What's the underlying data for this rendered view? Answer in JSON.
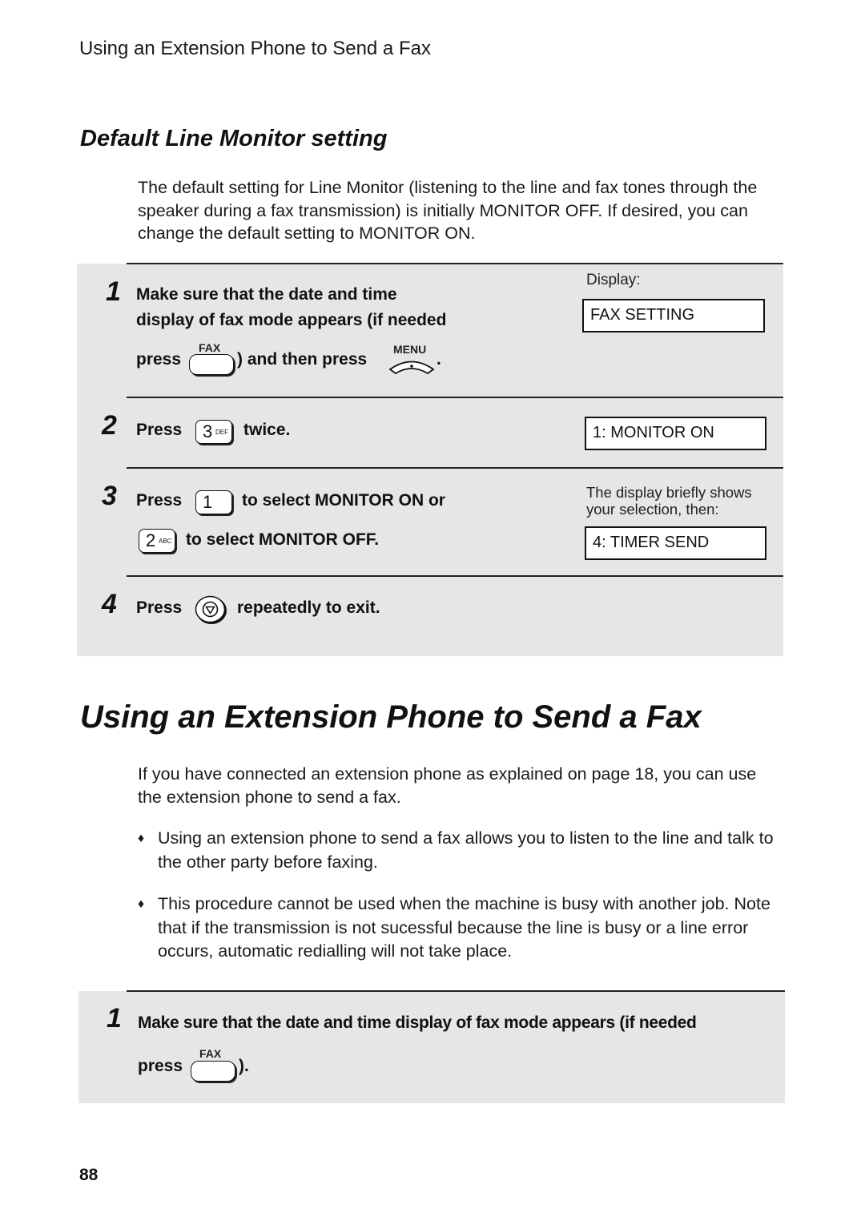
{
  "running_head": "Using an Extension Phone to Send a Fax",
  "subsection": {
    "title": "Default Line Monitor setting",
    "intro": "The default setting for Line Monitor (listening to the line and fax tones through the speaker during a fax transmission) is initially MONITOR OFF. If desired, you can change the default setting to MONITOR ON."
  },
  "steps_panel": {
    "display_label": "Display:",
    "steps": [
      {
        "number": "1",
        "line1": "Make sure that the date and time",
        "line2": "display of fax mode appears (if needed",
        "press": "press",
        "fax_key_label": "FAX",
        "and_then_press": ") and then press",
        "menu_key_label": "MENU",
        "period": ".",
        "display": "FAX SETTING"
      },
      {
        "number": "2",
        "press": "Press",
        "key_digit": "3",
        "key_letters": "DEF",
        "suffix": "twice.",
        "display": "1: MONITOR ON"
      },
      {
        "number": "3",
        "press": "Press",
        "key1_digit": "1",
        "line1_suffix": "to select MONITOR ON or",
        "key2_digit": "2",
        "key2_letters": "ABC",
        "line2_suffix": "to select MONITOR OFF.",
        "note": "The display briefly shows your selection, then:",
        "display": "4: TIMER SEND"
      },
      {
        "number": "4",
        "press": "Press",
        "key_icon": "stop-icon",
        "suffix": "repeatedly to exit."
      }
    ]
  },
  "section": {
    "title": "Using an Extension Phone to Send a Fax",
    "intro": "If you have connected an extension phone as explained on page 18, you can use the extension phone to send a fax.",
    "bullet_symbol": "♦",
    "bullets": [
      "Using an extension phone to send a fax allows you to listen to the line and talk to the other party before faxing.",
      "This procedure cannot be used when the machine is busy with another job. Note that if the transmission is not sucessful because the line is busy or a line error occurs, automatic redialling will not take place."
    ]
  },
  "steps_panel_2": {
    "steps": [
      {
        "number": "1",
        "line1": "Make sure that the date and time display of fax mode appears (if needed",
        "press": "press",
        "fax_key_label": "FAX",
        "closing": ")."
      }
    ]
  },
  "page_number": "88"
}
